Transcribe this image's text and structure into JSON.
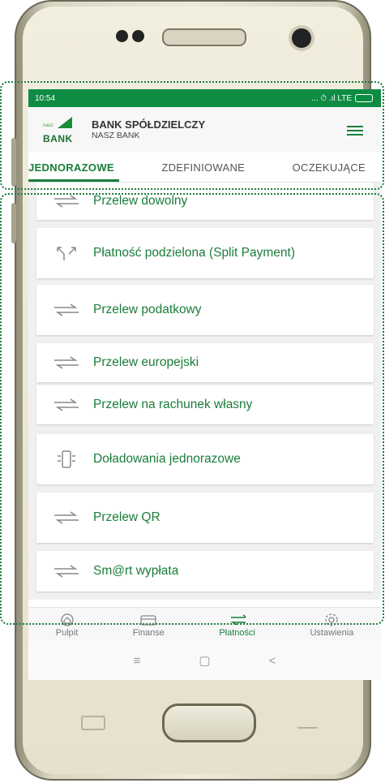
{
  "status_bar": {
    "time": "10:54",
    "indicators": "... ⏱ .ıl LTE"
  },
  "header": {
    "logo_small": "nasz",
    "logo_text": "BANK",
    "bank_line1": "BANK SPÓŁDZIELCZY",
    "bank_line2": "NASZ BANK",
    "menu_icon": "hamburger-icon"
  },
  "tabs": [
    "JEDNORAZOWE",
    "ZDEFINIOWANE",
    "OCZEKUJĄCE"
  ],
  "payments": [
    {
      "label": "Przelew dowolny",
      "icon": "transfer-arrows-icon"
    },
    {
      "label": "Płatność podzielona (Split Payment)",
      "icon": "split-arrows-icon"
    },
    {
      "label": "Przelew podatkowy",
      "icon": "transfer-arrows-icon"
    },
    {
      "label": "Przelew europejski",
      "icon": "transfer-arrows-icon"
    },
    {
      "label": "Przelew na rachunek własny",
      "icon": "transfer-arrows-icon"
    },
    {
      "label": "Doładowania jednorazowe",
      "icon": "phone-topup-icon"
    },
    {
      "label": "Przelew QR",
      "icon": "transfer-arrows-icon"
    },
    {
      "label": "Sm@rt wypłata",
      "icon": "transfer-arrows-icon"
    }
  ],
  "bottom_nav": [
    {
      "label": "Pulpit",
      "icon": "home-icon"
    },
    {
      "label": "Finanse",
      "icon": "wallet-icon"
    },
    {
      "label": "Płatności",
      "icon": "transfer-arrows-icon"
    },
    {
      "label": "Ustawienia",
      "icon": "gear-icon"
    }
  ],
  "system_nav": {
    "menu": "≡",
    "home": "▢",
    "back": "<"
  },
  "colors": {
    "brand_green": "#1a7d3a",
    "status_green": "#0e8c43",
    "highlight_dotted": "#1a7d3a"
  }
}
